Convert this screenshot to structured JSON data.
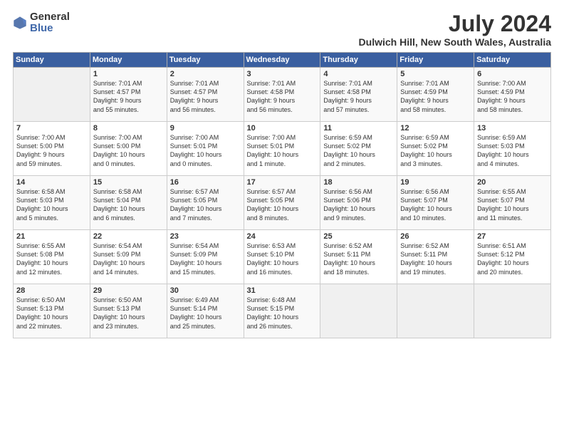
{
  "header": {
    "logo_general": "General",
    "logo_blue": "Blue",
    "month_year": "July 2024",
    "location": "Dulwich Hill, New South Wales, Australia"
  },
  "days_of_week": [
    "Sunday",
    "Monday",
    "Tuesday",
    "Wednesday",
    "Thursday",
    "Friday",
    "Saturday"
  ],
  "weeks": [
    [
      {
        "day": "",
        "info": ""
      },
      {
        "day": "1",
        "info": "Sunrise: 7:01 AM\nSunset: 4:57 PM\nDaylight: 9 hours\nand 55 minutes."
      },
      {
        "day": "2",
        "info": "Sunrise: 7:01 AM\nSunset: 4:57 PM\nDaylight: 9 hours\nand 56 minutes."
      },
      {
        "day": "3",
        "info": "Sunrise: 7:01 AM\nSunset: 4:58 PM\nDaylight: 9 hours\nand 56 minutes."
      },
      {
        "day": "4",
        "info": "Sunrise: 7:01 AM\nSunset: 4:58 PM\nDaylight: 9 hours\nand 57 minutes."
      },
      {
        "day": "5",
        "info": "Sunrise: 7:01 AM\nSunset: 4:59 PM\nDaylight: 9 hours\nand 58 minutes."
      },
      {
        "day": "6",
        "info": "Sunrise: 7:00 AM\nSunset: 4:59 PM\nDaylight: 9 hours\nand 58 minutes."
      }
    ],
    [
      {
        "day": "7",
        "info": "Sunrise: 7:00 AM\nSunset: 5:00 PM\nDaylight: 9 hours\nand 59 minutes."
      },
      {
        "day": "8",
        "info": "Sunrise: 7:00 AM\nSunset: 5:00 PM\nDaylight: 10 hours\nand 0 minutes."
      },
      {
        "day": "9",
        "info": "Sunrise: 7:00 AM\nSunset: 5:01 PM\nDaylight: 10 hours\nand 0 minutes."
      },
      {
        "day": "10",
        "info": "Sunrise: 7:00 AM\nSunset: 5:01 PM\nDaylight: 10 hours\nand 1 minute."
      },
      {
        "day": "11",
        "info": "Sunrise: 6:59 AM\nSunset: 5:02 PM\nDaylight: 10 hours\nand 2 minutes."
      },
      {
        "day": "12",
        "info": "Sunrise: 6:59 AM\nSunset: 5:02 PM\nDaylight: 10 hours\nand 3 minutes."
      },
      {
        "day": "13",
        "info": "Sunrise: 6:59 AM\nSunset: 5:03 PM\nDaylight: 10 hours\nand 4 minutes."
      }
    ],
    [
      {
        "day": "14",
        "info": "Sunrise: 6:58 AM\nSunset: 5:03 PM\nDaylight: 10 hours\nand 5 minutes."
      },
      {
        "day": "15",
        "info": "Sunrise: 6:58 AM\nSunset: 5:04 PM\nDaylight: 10 hours\nand 6 minutes."
      },
      {
        "day": "16",
        "info": "Sunrise: 6:57 AM\nSunset: 5:05 PM\nDaylight: 10 hours\nand 7 minutes."
      },
      {
        "day": "17",
        "info": "Sunrise: 6:57 AM\nSunset: 5:05 PM\nDaylight: 10 hours\nand 8 minutes."
      },
      {
        "day": "18",
        "info": "Sunrise: 6:56 AM\nSunset: 5:06 PM\nDaylight: 10 hours\nand 9 minutes."
      },
      {
        "day": "19",
        "info": "Sunrise: 6:56 AM\nSunset: 5:07 PM\nDaylight: 10 hours\nand 10 minutes."
      },
      {
        "day": "20",
        "info": "Sunrise: 6:55 AM\nSunset: 5:07 PM\nDaylight: 10 hours\nand 11 minutes."
      }
    ],
    [
      {
        "day": "21",
        "info": "Sunrise: 6:55 AM\nSunset: 5:08 PM\nDaylight: 10 hours\nand 12 minutes."
      },
      {
        "day": "22",
        "info": "Sunrise: 6:54 AM\nSunset: 5:09 PM\nDaylight: 10 hours\nand 14 minutes."
      },
      {
        "day": "23",
        "info": "Sunrise: 6:54 AM\nSunset: 5:09 PM\nDaylight: 10 hours\nand 15 minutes."
      },
      {
        "day": "24",
        "info": "Sunrise: 6:53 AM\nSunset: 5:10 PM\nDaylight: 10 hours\nand 16 minutes."
      },
      {
        "day": "25",
        "info": "Sunrise: 6:52 AM\nSunset: 5:11 PM\nDaylight: 10 hours\nand 18 minutes."
      },
      {
        "day": "26",
        "info": "Sunrise: 6:52 AM\nSunset: 5:11 PM\nDaylight: 10 hours\nand 19 minutes."
      },
      {
        "day": "27",
        "info": "Sunrise: 6:51 AM\nSunset: 5:12 PM\nDaylight: 10 hours\nand 20 minutes."
      }
    ],
    [
      {
        "day": "28",
        "info": "Sunrise: 6:50 AM\nSunset: 5:13 PM\nDaylight: 10 hours\nand 22 minutes."
      },
      {
        "day": "29",
        "info": "Sunrise: 6:50 AM\nSunset: 5:13 PM\nDaylight: 10 hours\nand 23 minutes."
      },
      {
        "day": "30",
        "info": "Sunrise: 6:49 AM\nSunset: 5:14 PM\nDaylight: 10 hours\nand 25 minutes."
      },
      {
        "day": "31",
        "info": "Sunrise: 6:48 AM\nSunset: 5:15 PM\nDaylight: 10 hours\nand 26 minutes."
      },
      {
        "day": "",
        "info": ""
      },
      {
        "day": "",
        "info": ""
      },
      {
        "day": "",
        "info": ""
      }
    ]
  ]
}
